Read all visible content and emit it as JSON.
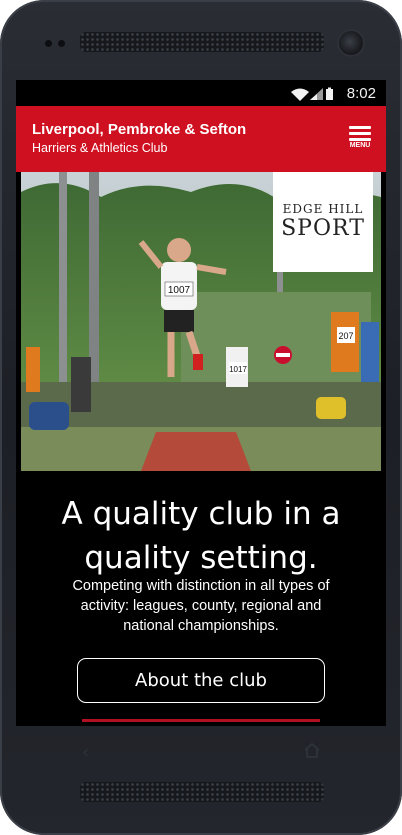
{
  "status_bar": {
    "time": "8:02"
  },
  "header": {
    "title": "Liverpool, Pembroke & Sefton",
    "subtitle": "Harriers & Athletics Club",
    "menu_label": "MENU"
  },
  "hero": {
    "logo": {
      "line1": "EDGE HILL",
      "line2": "SPORT"
    },
    "bibs": [
      "1007",
      "207",
      "1017"
    ]
  },
  "content": {
    "headline_line1": "A quality club in a",
    "headline_line2": "quality setting.",
    "tagline_line1": "Competing with distinction in all types of",
    "tagline_line2": "activity: leagues, county, regional and",
    "tagline_line3": "national championships.",
    "cta_label": "About the club"
  },
  "colors": {
    "brand_red": "#cf1020",
    "screen_bg": "#000000",
    "phone_body": "#22252b"
  }
}
